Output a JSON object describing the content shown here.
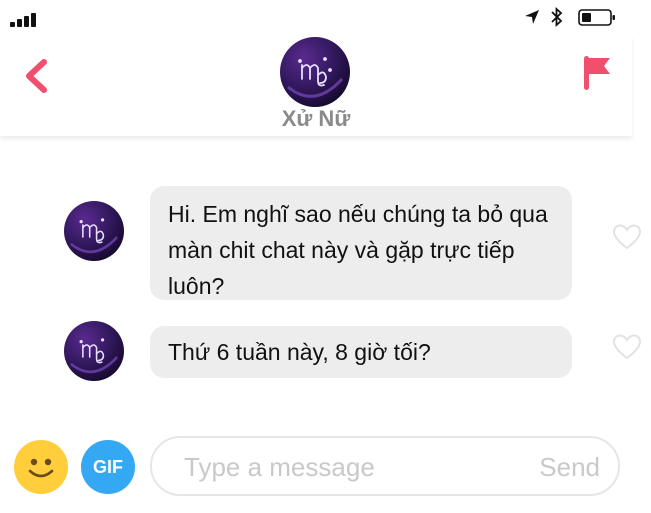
{
  "status_bar": {
    "signal": "signal-bars-icon",
    "location": "location-arrow-icon",
    "bluetooth": "bluetooth-icon",
    "battery": "battery-icon"
  },
  "header": {
    "back_icon": "chevron-left-icon",
    "flag_icon": "flag-icon",
    "profile_name": "Xử Nữ",
    "avatar_icon": "virgo-symbol-icon",
    "accent_color": "#f0506e"
  },
  "messages": [
    {
      "text": "Hi. Em nghĩ sao nếu chúng ta bỏ qua màn chit chat này và gặp trực tiếp luôn?"
    },
    {
      "text": "Thứ 6 tuần này, 8 giờ tối?"
    }
  ],
  "composer": {
    "emoji_icon": "smiley-icon",
    "gif_label": "GIF",
    "placeholder": "Type a message",
    "value": "",
    "send_label": "Send"
  }
}
